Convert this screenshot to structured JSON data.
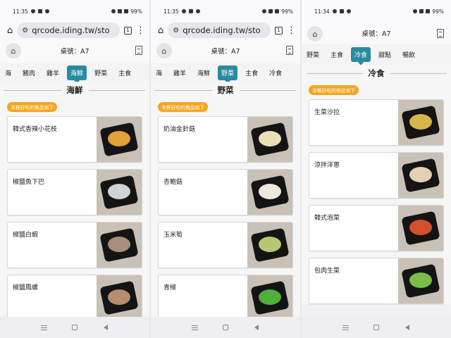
{
  "screens": [
    {
      "status_time": "11:35",
      "battery": "99%",
      "url": "qrcode.iding.tw/sto",
      "tab_count": "1",
      "table_label": "桌號：A7",
      "tabs": [
        "海",
        "豬肉",
        "雞羊",
        "海鮮",
        "野菜",
        "主食"
      ],
      "active_tab_index": 3,
      "section_title": "海鮮",
      "hint": "本餐好吃的餐品如下",
      "items": [
        {
          "name": "韓式香辣小花枝",
          "food_color": "#e0a237"
        },
        {
          "name": "椒鹽魚下巴",
          "food_color": "#cfd3d8"
        },
        {
          "name": "椒鹽白蝦",
          "food_color": "#a88e7a"
        },
        {
          "name": "椒鹽鳳螺",
          "food_color": "#b78d70"
        }
      ]
    },
    {
      "status_time": "11:35",
      "battery": "99%",
      "url": "qrcode.iding.tw/sto",
      "tab_count": "1",
      "table_label": "桌號：A7",
      "tabs": [
        "海",
        "雞羊",
        "海鮮",
        "野菜",
        "主食",
        "冷食"
      ],
      "active_tab_index": 3,
      "section_title": "野菜",
      "hint": "本餐好吃的餐品如下",
      "items": [
        {
          "name": "奶油金針菇",
          "food_color": "#e9dfb8"
        },
        {
          "name": "杏鮑菇",
          "food_color": "#efe9dd"
        },
        {
          "name": "玉米筍",
          "food_color": "#b7c872"
        },
        {
          "name": "青椒",
          "food_color": "#4fae3c"
        }
      ]
    },
    {
      "status_time": "11:34",
      "battery": "99%",
      "table_label": "桌號：A7",
      "tabs": [
        "野菜",
        "主食",
        "冷食",
        "甜點",
        "暢飲"
      ],
      "active_tab_index": 2,
      "section_title": "冷食",
      "hint": "本餐好吃的餐品如下",
      "items": [
        {
          "name": "生菜沙拉",
          "food_color": "#d9b64a"
        },
        {
          "name": "涼拌洋蔥",
          "food_color": "#e4d0b4"
        },
        {
          "name": "韓式泡菜",
          "food_color": "#d2502b"
        },
        {
          "name": "包肉生菜",
          "food_color": "#7cbc48"
        }
      ]
    }
  ],
  "colors": {
    "accent": "#2b8aa0",
    "hint": "#f3a623"
  }
}
